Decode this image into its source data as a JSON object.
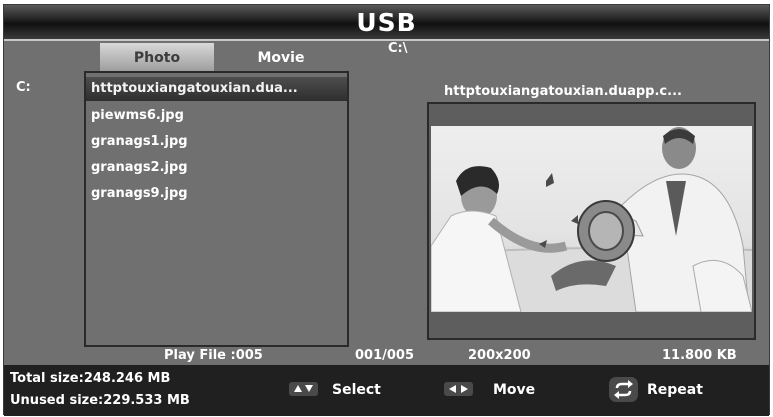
{
  "header": {
    "title": "USB"
  },
  "tabs": [
    {
      "label": "Photo",
      "active": true
    },
    {
      "label": "Movie",
      "active": false
    }
  ],
  "path": "C:\\",
  "drive_label": "C:",
  "files": [
    {
      "name": "httptouxiangatouxian.dua...",
      "selected": true
    },
    {
      "name": "piewms6.jpg",
      "selected": false
    },
    {
      "name": "granags1.jpg",
      "selected": false
    },
    {
      "name": "granags2.jpg",
      "selected": false
    },
    {
      "name": "granags9.jpg",
      "selected": false
    }
  ],
  "preview": {
    "filename": "httptouxiangatouxian.duapp.c..."
  },
  "status": {
    "play_file": "Play File  :005",
    "position": "001/005",
    "resolution": "200x200",
    "file_size": "11.800  KB"
  },
  "storage": {
    "total": "Total size:248.246 MB",
    "unused": "Unused size:229.533 MB"
  },
  "hints": [
    {
      "icon": "up-down-arrows-icon",
      "label": "Select"
    },
    {
      "icon": "left-right-arrows-icon",
      "label": "Move"
    },
    {
      "icon": "repeat-icon",
      "label": "Repeat"
    }
  ]
}
